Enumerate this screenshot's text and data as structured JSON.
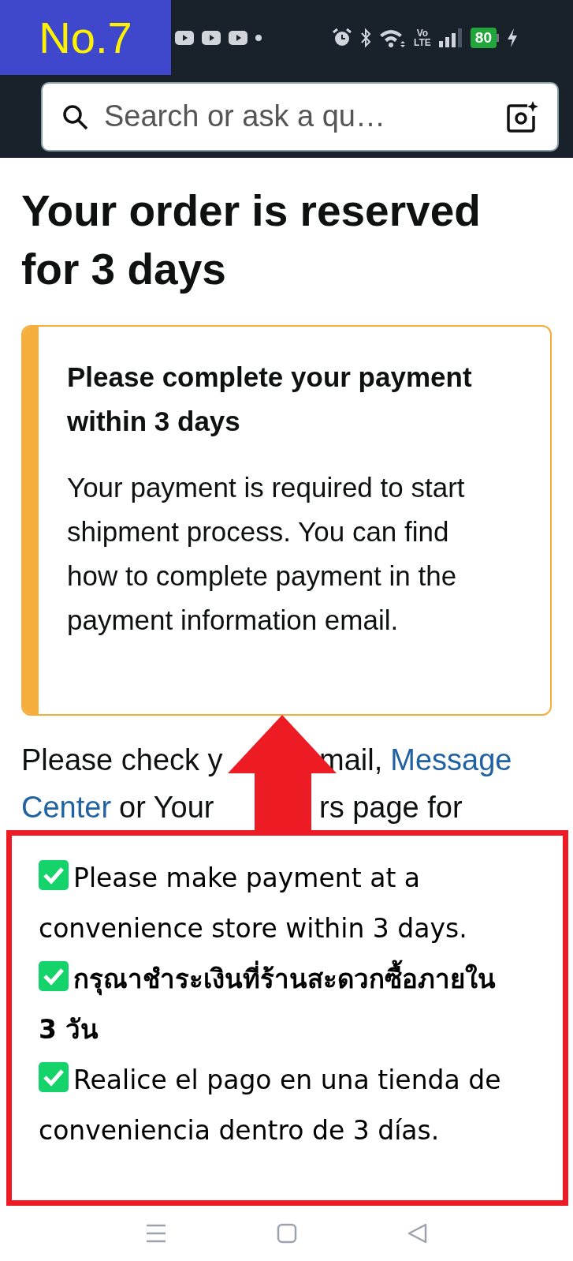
{
  "annotation_label": "No.7",
  "status_bar": {
    "network_label_top": "Vo",
    "network_label_bottom": "LTE",
    "battery": "80",
    "charging": true
  },
  "search": {
    "placeholder": "Search or ask a qu…"
  },
  "title": "Your order is reserved for 3 days",
  "notice": {
    "heading": "Please complete your payment within 3 days",
    "body": "Your payment is required to start shipment process. You can find how to complete payment in the payment information email."
  },
  "paragraph": {
    "lines": [
      {
        "left": [
          {
            "text": "Please check y",
            "kind": "text"
          }
        ],
        "right": [
          {
            "text": "mail,",
            "kind": "text"
          },
          {
            "text": "Message",
            "kind": "link"
          }
        ]
      },
      {
        "left": [
          {
            "text": "Center",
            "kind": "link"
          },
          {
            "text": "or Your",
            "kind": "text"
          }
        ],
        "right": [
          {
            "text": "rs page for",
            "kind": "text"
          }
        ]
      }
    ]
  },
  "callout": {
    "items": [
      {
        "text": "Please make payment at a convenience store within 3 days.",
        "checked": true,
        "bold": false
      },
      {
        "text": "กรุณาชำระเงินที่ร้านสะดวกซื้อภายใน 3 วัน",
        "checked": true,
        "bold": true
      },
      {
        "text": "Realice el pago en una tienda de conveniencia dentro de 3 días.",
        "checked": true,
        "bold": false
      }
    ]
  }
}
